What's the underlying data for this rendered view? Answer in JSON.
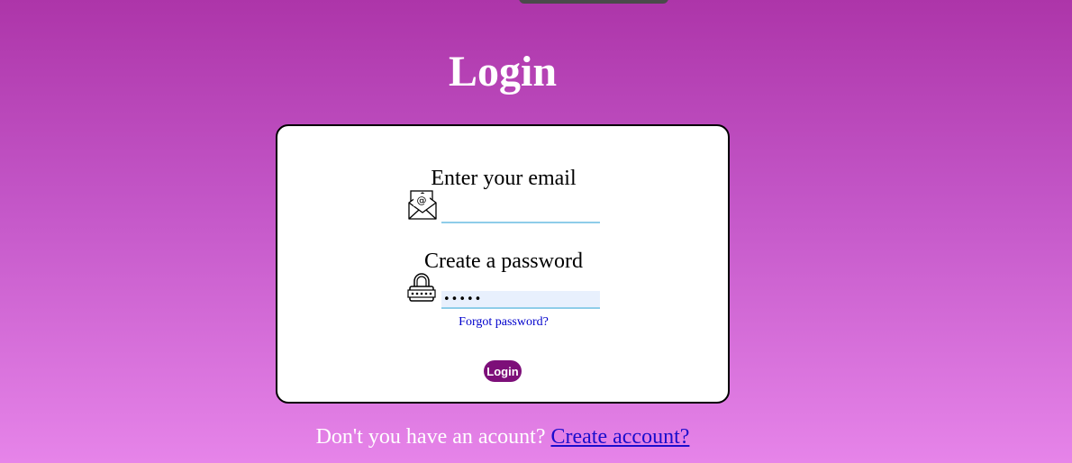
{
  "page": {
    "title": "Login"
  },
  "form": {
    "email_label": "Enter your email",
    "email_value": "",
    "email_icon": "envelope-at-icon",
    "password_label": "Create a password",
    "password_value": "12345",
    "password_icon": "padlock-icon",
    "forgot_link": "Forgot password?",
    "login_button": "Login"
  },
  "footer": {
    "prompt_text": "Don't you have an acount?",
    "create_account_link": "Create account?"
  },
  "colors": {
    "background_top": "#ad35a9",
    "background_bottom": "#e684e9",
    "button": "#7d0f79",
    "input_underline": "#8ecde9"
  }
}
